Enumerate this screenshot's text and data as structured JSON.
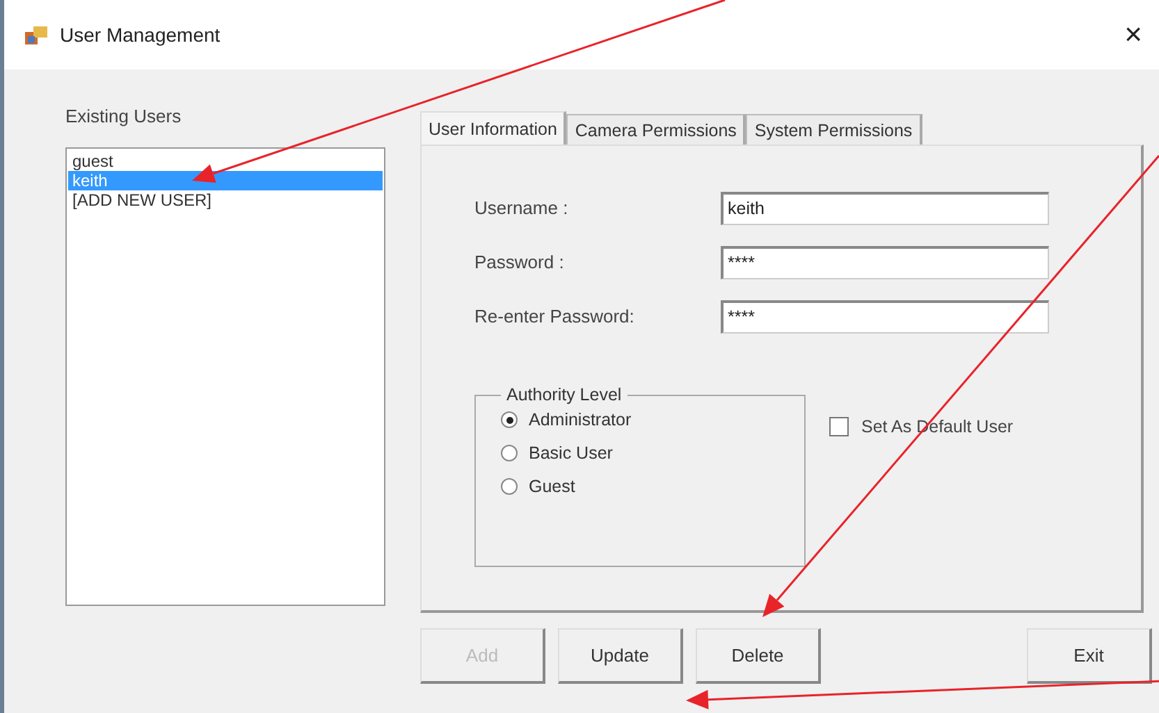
{
  "window": {
    "title": "User Management",
    "close": "×"
  },
  "users": {
    "label": "Existing Users",
    "items": [
      {
        "name": "guest",
        "selected": false
      },
      {
        "name": "keith",
        "selected": true
      },
      {
        "name": "[ADD NEW USER]",
        "selected": false
      }
    ]
  },
  "tabs": [
    {
      "label": "User Information",
      "selected": true
    },
    {
      "label": "Camera Permissions",
      "selected": false
    },
    {
      "label": "System Permissions",
      "selected": false
    }
  ],
  "fields": [
    {
      "label": "Username :",
      "value": "keith"
    },
    {
      "label": "Password :",
      "value": "****"
    },
    {
      "label": "Re-enter Password:",
      "value": "****"
    }
  ],
  "authority": {
    "legend": "Authority Level",
    "options": [
      {
        "label": "Administrator",
        "selected": true
      },
      {
        "label": "Basic User",
        "selected": false
      },
      {
        "label": "Guest",
        "selected": false
      }
    ]
  },
  "default_user": {
    "label": "Set As Default User",
    "checked": false
  },
  "buttons": [
    {
      "label": "Add",
      "disabled": true
    },
    {
      "label": "Update",
      "disabled": false
    },
    {
      "label": "Delete",
      "disabled": false
    }
  ],
  "exit_button": {
    "label": "Exit",
    "disabled": false
  }
}
